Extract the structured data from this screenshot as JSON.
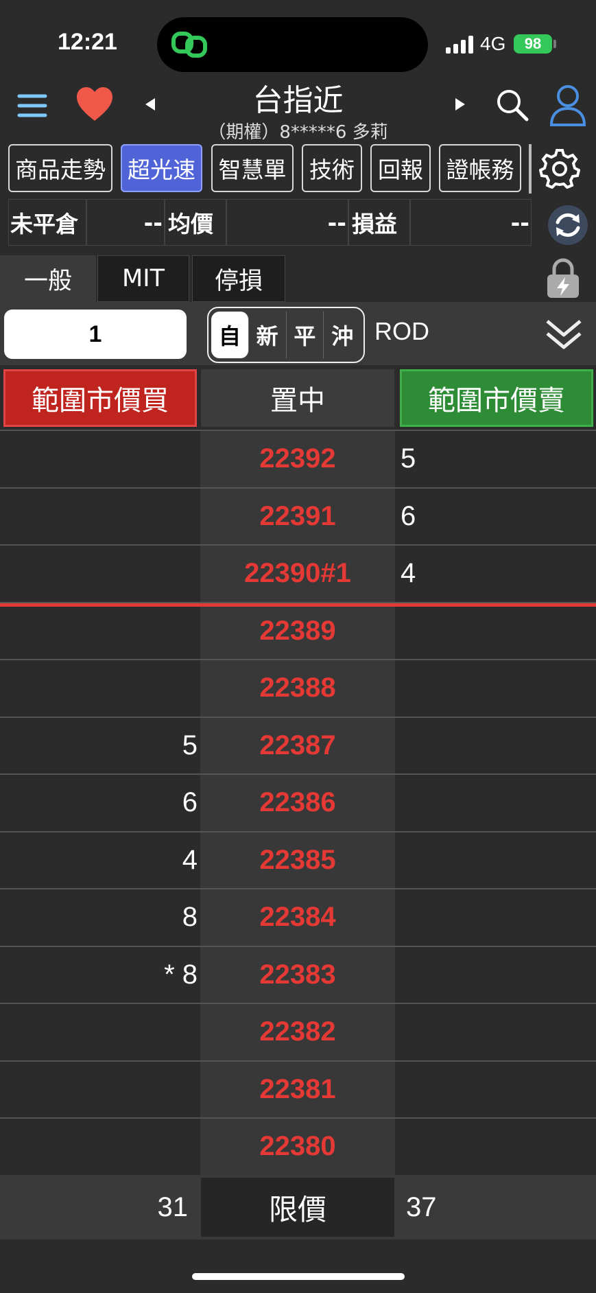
{
  "status": {
    "time": "12:21",
    "network": "4G",
    "battery": "98"
  },
  "header": {
    "title": "台指近",
    "subtitle": "（期權）8*****6 多莉"
  },
  "nav": [
    {
      "label": "商品走勢"
    },
    {
      "label": "超光速"
    },
    {
      "label": "智慧單"
    },
    {
      "label": "技術"
    },
    {
      "label": "回報"
    },
    {
      "label": "證帳務"
    }
  ],
  "summary": {
    "open_label": "未平倉",
    "open_value": "--",
    "avg_label": "均價",
    "avg_value": "--",
    "pnl_label": "損益",
    "pnl_value": "--"
  },
  "tabs": [
    {
      "label": "一般"
    },
    {
      "label": "MIT"
    },
    {
      "label": "停損"
    }
  ],
  "order": {
    "quantity": "1",
    "modes": [
      {
        "label": "自"
      },
      {
        "label": "新"
      },
      {
        "label": "平"
      },
      {
        "label": "沖"
      }
    ],
    "selected_mode": "自",
    "time_in_force": "ROD"
  },
  "actions": {
    "buy": "範圍市價買",
    "center": "置中",
    "sell": "範圍市價賣"
  },
  "ladder": [
    {
      "buy": "",
      "price": "22392",
      "sell": "5"
    },
    {
      "buy": "",
      "price": "22391",
      "sell": "6"
    },
    {
      "buy": "",
      "price": "22390#1",
      "sell": "4"
    },
    {
      "buy": "",
      "price": "22389",
      "sell": ""
    },
    {
      "buy": "",
      "price": "22388",
      "sell": ""
    },
    {
      "buy": "5",
      "price": "22387",
      "sell": ""
    },
    {
      "buy": "6",
      "price": "22386",
      "sell": ""
    },
    {
      "buy": "4",
      "price": "22385",
      "sell": ""
    },
    {
      "buy": "8",
      "price": "22384",
      "sell": ""
    },
    {
      "buy": "* 8",
      "price": "22383",
      "sell": ""
    },
    {
      "buy": "",
      "price": "22382",
      "sell": ""
    },
    {
      "buy": "",
      "price": "22381",
      "sell": ""
    },
    {
      "buy": "",
      "price": "22380",
      "sell": ""
    }
  ],
  "footer": {
    "buy_total": "31",
    "center": "限價",
    "sell_total": "37"
  },
  "colors": {
    "buy": "#c0241f",
    "sell": "#2e8b36",
    "price": "#e53935",
    "active_tab": "#5064d8"
  }
}
